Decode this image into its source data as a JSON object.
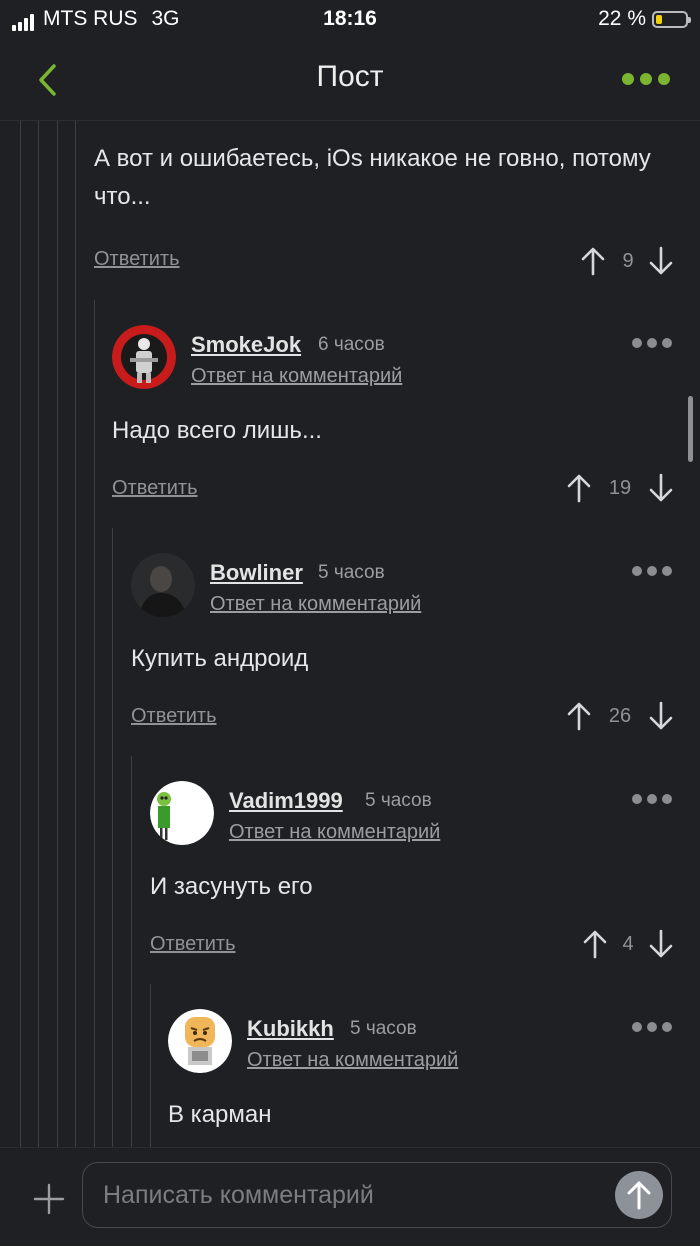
{
  "status_bar": {
    "carrier": "MTS RUS",
    "network": "3G",
    "time": "18:16",
    "battery_percent": "22 %",
    "battery_level": 0.22
  },
  "nav": {
    "title": "Пост",
    "back_icon": "chevron-left-icon",
    "more_icon": "more-dots-icon",
    "accent_color": "#7bb430"
  },
  "comments": [
    {
      "nick": "",
      "body": "А вот и ошибаетесь, iOs никакое не говно, потому что...",
      "answer_label": "Ответить",
      "score": "9"
    },
    {
      "nick": "SmokeJok",
      "age": "6 часов",
      "reply_to": "Ответ на комментарий",
      "body": "Надо всего лишь...",
      "answer_label": "Ответить",
      "score": "19"
    },
    {
      "nick": "Bowliner",
      "age": "5 часов",
      "reply_to": "Ответ на комментарий",
      "body": "Купить андроид",
      "answer_label": "Ответить",
      "score": "26"
    },
    {
      "nick": "Vadim1999",
      "age": "5 часов",
      "reply_to": "Ответ на комментарий",
      "body": "И засунуть его",
      "answer_label": "Ответить",
      "score": "4"
    },
    {
      "nick": "Kubikkh",
      "age": "5 часов",
      "reply_to": "Ответ на комментарий",
      "body": "В карман"
    }
  ],
  "composer": {
    "placeholder": "Написать комментарий",
    "add_icon": "plus-icon",
    "send_icon": "send-arrow-icon"
  }
}
